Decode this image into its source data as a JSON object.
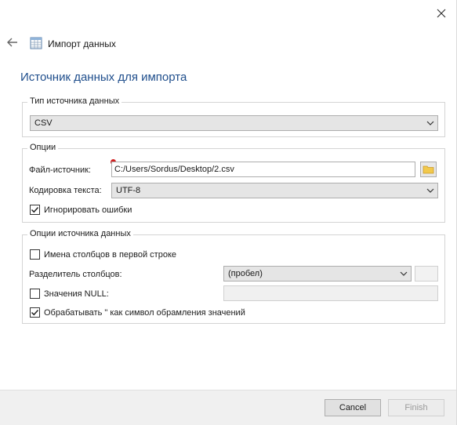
{
  "window": {
    "app_title": "Импорт данных",
    "heading": "Источник данных для импорта"
  },
  "source_type": {
    "legend": "Тип источника данных",
    "selected": "CSV"
  },
  "options": {
    "legend": "Опции",
    "file_label": "Файл-источник:",
    "file_value": "C:/Users/Sordus/Desktop/2.csv",
    "encoding_label": "Кодировка текста:",
    "encoding_value": "UTF-8",
    "ignore_errors_label": "Игнорировать ошибки",
    "ignore_errors_checked": true
  },
  "source_options": {
    "legend": "Опции источника данных",
    "header_row_label": "Имена столбцов в первой строке",
    "header_row_checked": false,
    "separator_label": "Разделитель столбцов:",
    "separator_value": "(пробел)",
    "null_label": "Значения NULL:",
    "null_checked": false,
    "null_value": "",
    "quote_label": "Обрабатывать \" как символ обрамления значений",
    "quote_checked": true
  },
  "footer": {
    "cancel_label": "Cancel",
    "finish_label": "Finish"
  },
  "colors": {
    "heading": "#1f4e8c",
    "error": "#d11f1f"
  }
}
